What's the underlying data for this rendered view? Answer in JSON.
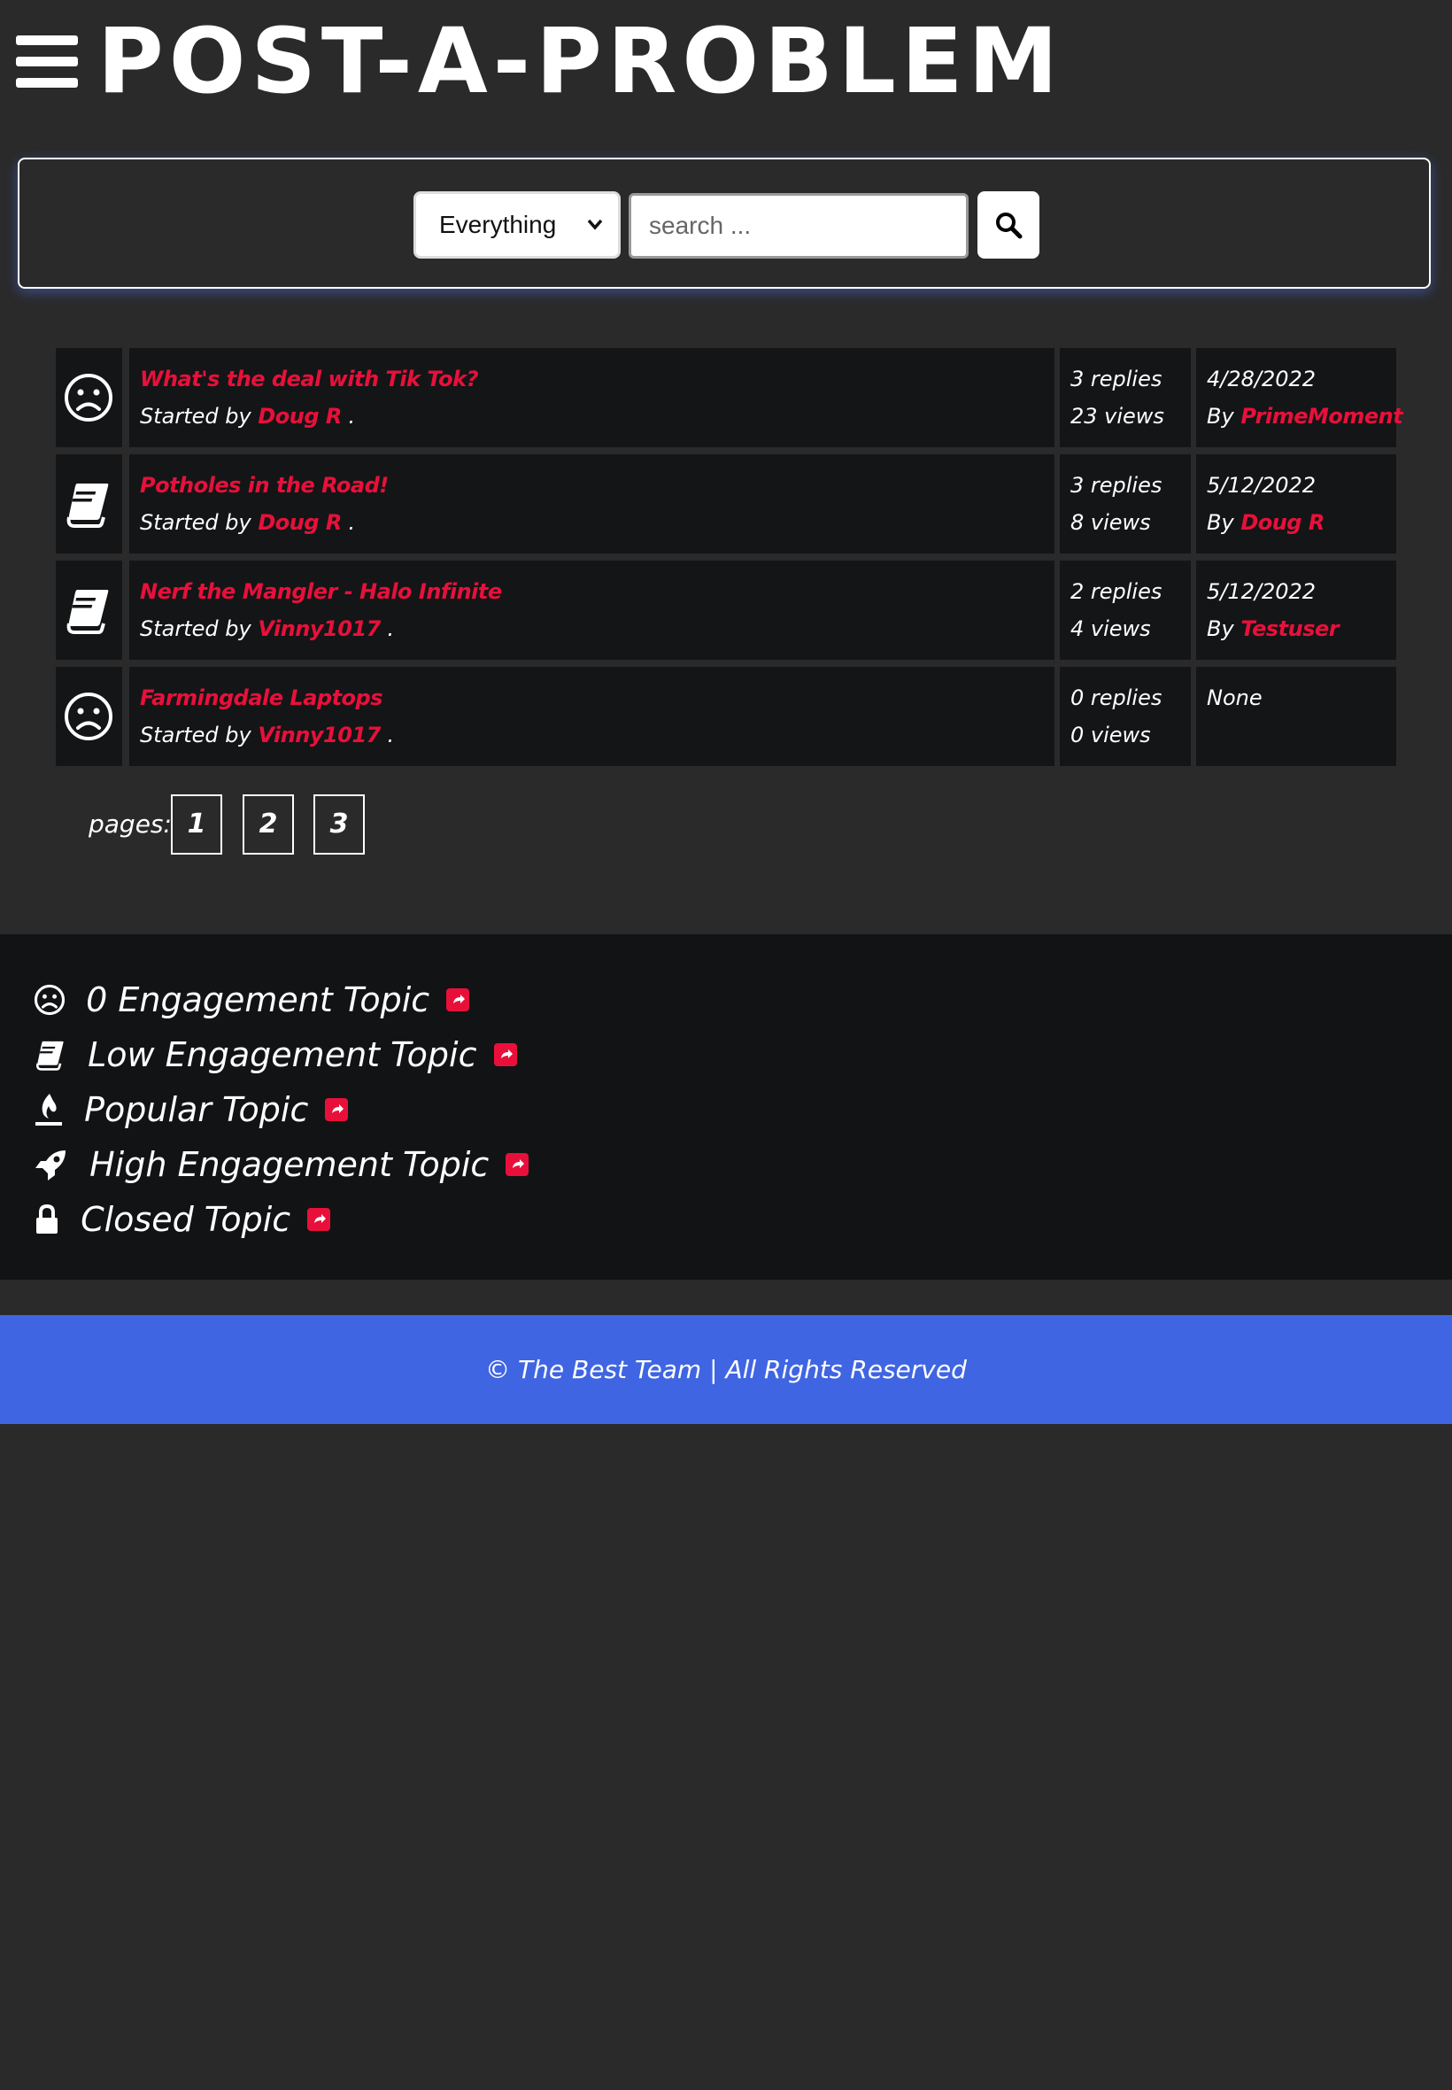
{
  "header": {
    "title": "POST-A-PROBLEM"
  },
  "search": {
    "category_selected": "Everything",
    "placeholder": "search ..."
  },
  "topics": [
    {
      "icon": "frown-icon",
      "title": "What's the deal with Tik Tok?",
      "started_by_prefix": "Started by",
      "author": "Doug R",
      "suffix": ".",
      "replies": "3 replies",
      "views": "23 views",
      "last_date": "4/28/2022",
      "last_by_prefix": "By",
      "last_by": "PrimeMoment"
    },
    {
      "icon": "book-icon",
      "title": "Potholes in the Road!",
      "started_by_prefix": "Started by",
      "author": "Doug R",
      "suffix": ".",
      "replies": "3 replies",
      "views": "8 views",
      "last_date": "5/12/2022",
      "last_by_prefix": "By",
      "last_by": "Doug R"
    },
    {
      "icon": "book-icon",
      "title": "Nerf the Mangler - Halo Infinite",
      "started_by_prefix": "Started by",
      "author": "Vinny1017",
      "suffix": ".",
      "replies": "2 replies",
      "views": "4 views",
      "last_date": "5/12/2022",
      "last_by_prefix": "By",
      "last_by": "Testuser"
    },
    {
      "icon": "frown-icon",
      "title": "Farmingdale Laptops",
      "started_by_prefix": "Started by",
      "author": "Vinny1017",
      "suffix": ".",
      "replies": "0 replies",
      "views": "0 views",
      "last_date": "",
      "last_by_prefix": "",
      "last_by": "",
      "last_none": "None"
    }
  ],
  "pagination": {
    "label": "pages:",
    "pages": [
      "1",
      "2",
      "3"
    ]
  },
  "legend": [
    {
      "icon": "frown-icon",
      "label": "0 Engagement Topic"
    },
    {
      "icon": "book-icon",
      "label": "Low Engagement Topic"
    },
    {
      "icon": "fire-icon",
      "label": "Popular Topic"
    },
    {
      "icon": "rocket-icon",
      "label": "High Engagement Topic"
    },
    {
      "icon": "lock-icon",
      "label": "Closed Topic"
    }
  ],
  "footer": {
    "text": "© The Best Team | All Rights Reserved"
  },
  "colors": {
    "background": "#2a2a2b",
    "panel": "#141517",
    "link": "#e8103a",
    "footer": "#3f65e2"
  }
}
